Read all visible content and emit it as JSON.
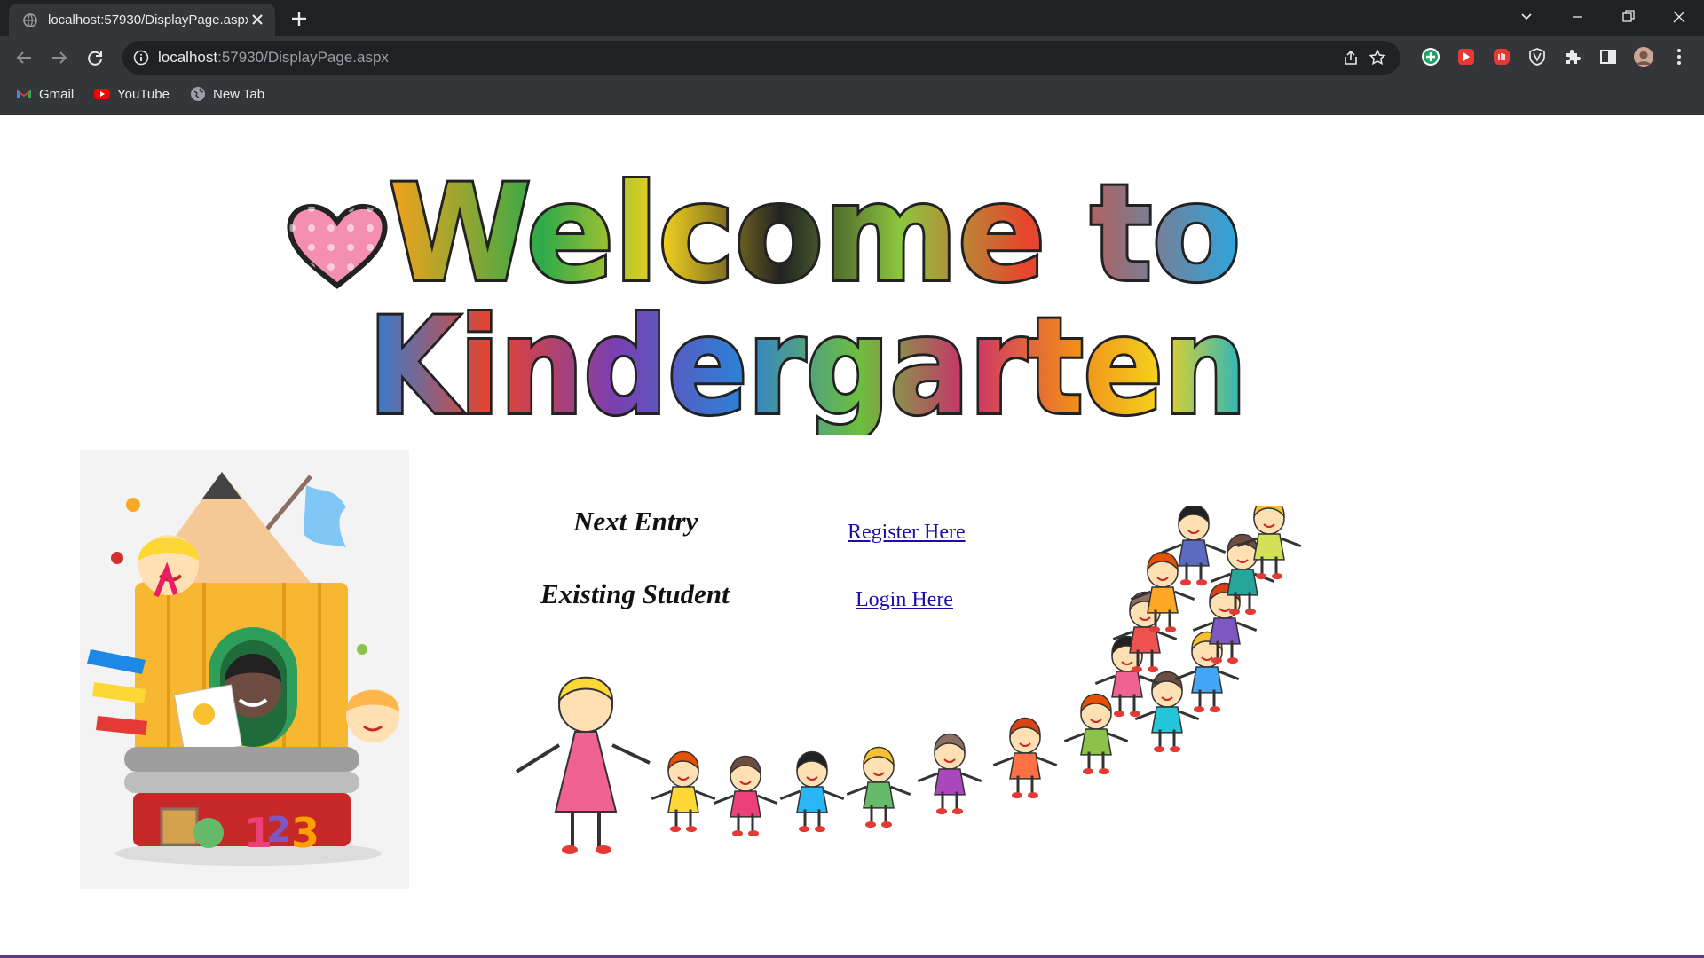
{
  "browser": {
    "tab_title": "localhost:57930/DisplayPage.aspx",
    "url_host": "localhost",
    "url_rest": ":57930/DisplayPage.aspx",
    "bookmarks": [
      {
        "label": "Gmail",
        "icon": "gmail-icon"
      },
      {
        "label": "YouTube",
        "icon": "youtube-icon"
      },
      {
        "label": "New Tab",
        "icon": "globe-icon"
      }
    ]
  },
  "page": {
    "banner_line1": "Welcome to",
    "banner_line2": "Kindergarten",
    "rows": [
      {
        "label": "Next Entry",
        "link": "Register Here"
      },
      {
        "label": "Existing Student",
        "link": "Login Here"
      }
    ]
  },
  "colors": {
    "link": "#1a0dab",
    "chrome_dark": "#202124",
    "chrome_toolbar": "#35363a",
    "divider": "#5b3a8c"
  }
}
